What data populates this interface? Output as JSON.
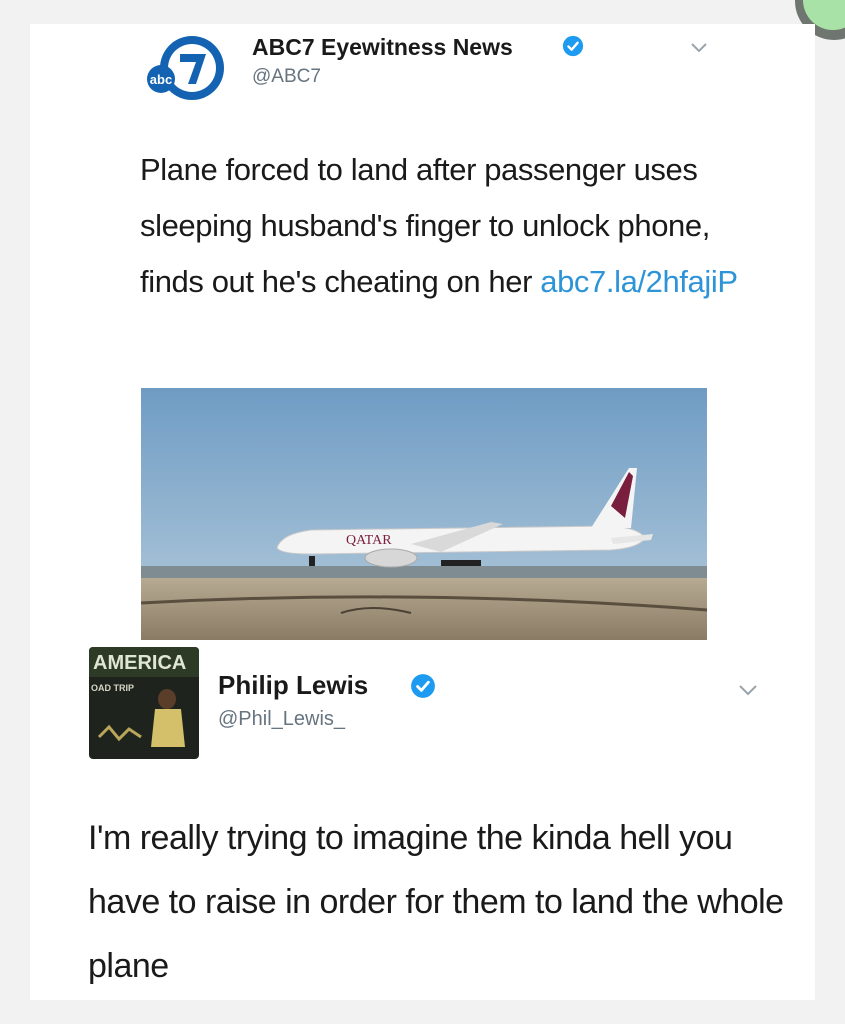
{
  "tweet1": {
    "author_name": "ABC7 Eyewitness News",
    "handle": "@ABC7",
    "logo_text": "abc",
    "logo_number": "7",
    "text": "Plane forced to land after passenger uses sleeping husband's finger to unlock phone, finds out he's cheating on her",
    "link": "abc7.la/2hfajiP",
    "photo_airline_text": "QATAR"
  },
  "tweet2": {
    "author_name": "Philip Lewis",
    "handle": "@Phil_Lewis_",
    "avatar_text_top": "AMERICA",
    "avatar_text_side": "OAD TRIP",
    "text": "I'm really trying to imagine the kinda hell you have to raise in order for them to land the whole plane"
  },
  "icons": {
    "verified": "verified-check-icon",
    "chevron": "chevron-down-icon"
  },
  "colors": {
    "verified_blue": "#1d9bf0",
    "link_blue": "#2e94d8",
    "handle_gray": "#667480",
    "abc_blue": "#1463b3",
    "qatar_maroon": "#7a1e3d"
  }
}
